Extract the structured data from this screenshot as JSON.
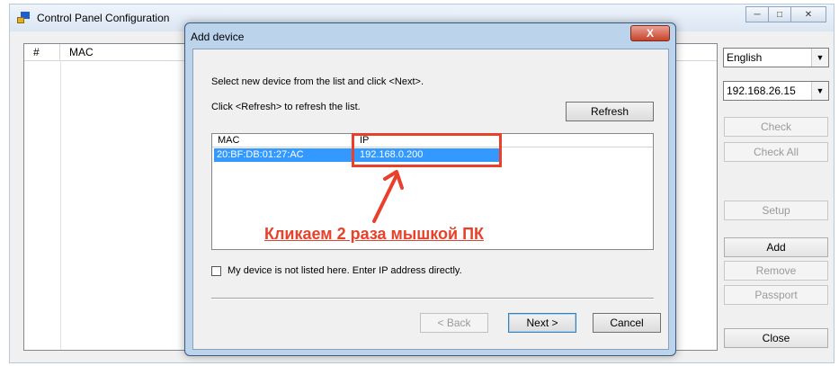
{
  "main_window": {
    "title": "Control Panel Configuration",
    "columns": [
      "#",
      "MAC"
    ],
    "window_controls": [
      "minimize",
      "maximize",
      "close"
    ]
  },
  "right_panel": {
    "language": "English",
    "ip": "192.168.26.15",
    "check": "Check",
    "check_all": "Check All",
    "setup": "Setup",
    "add": "Add",
    "remove": "Remove",
    "passport": "Passport",
    "close": "Close"
  },
  "dialog": {
    "title": "Add device",
    "close_glyph": "X",
    "instruction1": "Select new device from the list and click <Next>.",
    "instruction2": "Click <Refresh> to refresh the list.",
    "refresh": "Refresh",
    "list_columns": {
      "mac": "MAC",
      "ip": "IP"
    },
    "devices": [
      {
        "mac": "20:BF:DB:01:27:AC",
        "ip": "192.168.0.200"
      }
    ],
    "checkbox_label": "My device is not listed here. Enter IP address directly.",
    "back": "< Back",
    "next": "Next >",
    "cancel": "Cancel"
  },
  "annotation": {
    "text": "Кликаем 2 раза мышкой ПК",
    "color": "#e8402a"
  }
}
